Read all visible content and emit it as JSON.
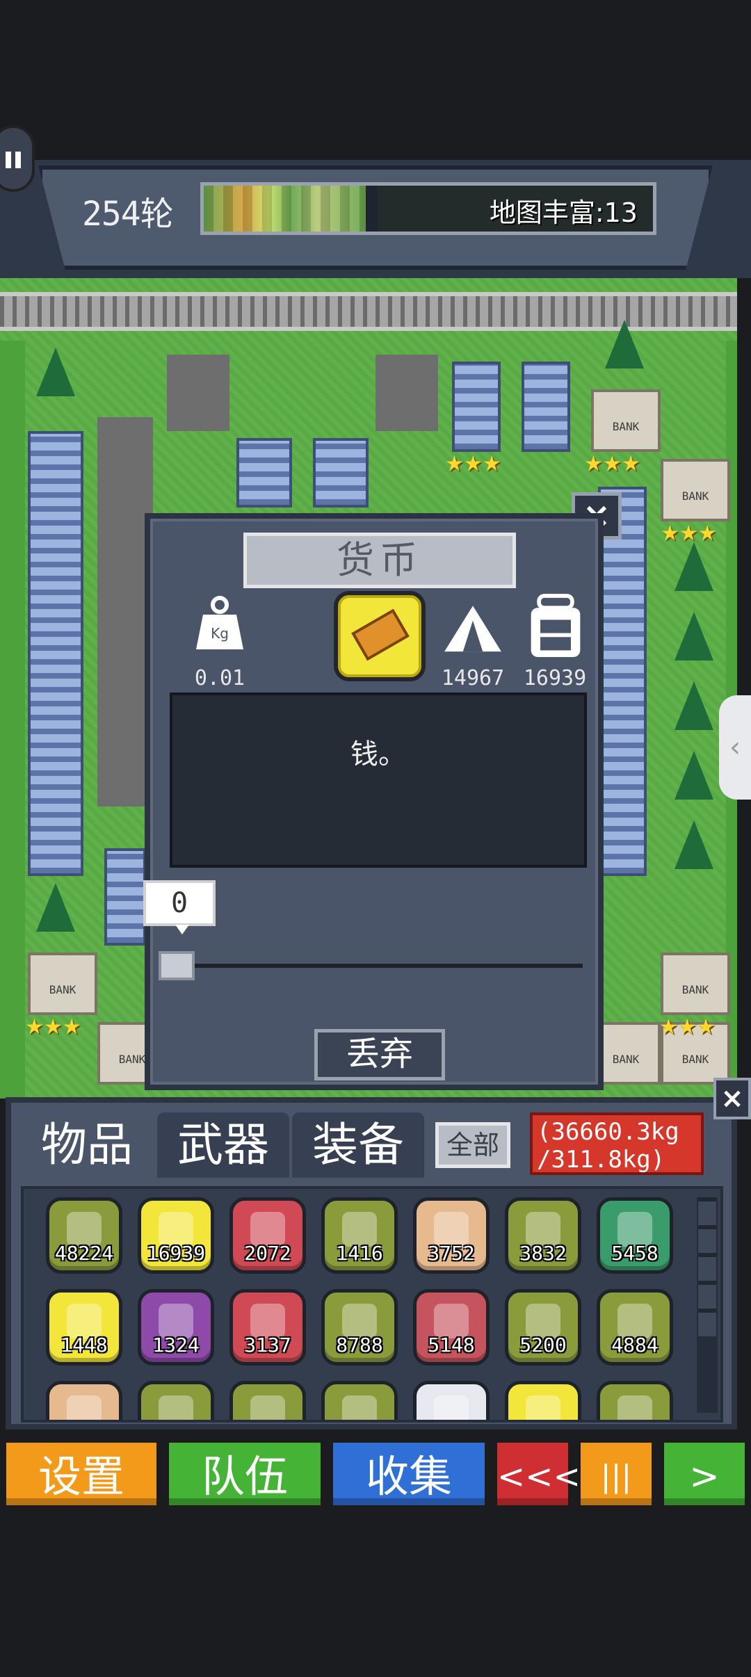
{
  "header": {
    "round": "254轮",
    "map_richness_label": "地图丰富:13",
    "map_richness_fill": 0.36
  },
  "dialog": {
    "title": "货币",
    "weight_unit": "Kg",
    "weight_value": "0.01",
    "camp_count": "14967",
    "backpack_count": "16939",
    "description": "钱。",
    "quantity": "0",
    "slider_value": 0,
    "discard_label": "丢弃",
    "close_label": "×"
  },
  "inventory": {
    "tabs": [
      "物品",
      "武器",
      "装备"
    ],
    "all_label": "全部",
    "weight_line1": "(36660.3kg",
    "weight_line2": "/311.8kg)",
    "close_label": "×",
    "rows": [
      [
        {
          "count": "48224",
          "bg": "#8a9b3c",
          "icon": "supplies-icon"
        },
        {
          "count": "16939",
          "bg": "#f2e63a",
          "icon": "currency-icon"
        },
        {
          "count": "2072",
          "bg": "#d04a55",
          "icon": "dynamite-icon"
        },
        {
          "count": "1416",
          "bg": "#8a9b3c",
          "icon": "herb-icon"
        },
        {
          "count": "3752",
          "bg": "#e7b98f",
          "icon": "rope-icon"
        },
        {
          "count": "3832",
          "bg": "#8a9b3c",
          "icon": "bottle-icon"
        },
        {
          "count": "5458",
          "bg": "#3a9c6a",
          "icon": "wood-log-icon"
        }
      ],
      [
        {
          "count": "1448",
          "bg": "#f2e63a",
          "icon": "potion-icon"
        },
        {
          "count": "1324",
          "bg": "#8d4aa8",
          "icon": "can-icon"
        },
        {
          "count": "3137",
          "bg": "#d04a55",
          "icon": "medkit-icon"
        },
        {
          "count": "8788",
          "bg": "#8a9b3c",
          "icon": "meat-icon"
        },
        {
          "count": "5148",
          "bg": "#c6545e",
          "icon": "shirt-icon"
        },
        {
          "count": "5200",
          "bg": "#8a9b3c",
          "icon": "chocolate-icon"
        },
        {
          "count": "4884",
          "bg": "#8a9b3c",
          "icon": "apple-icon"
        }
      ],
      [
        {
          "count": "",
          "bg": "#e7b98f",
          "icon": "mushroom-icon"
        },
        {
          "count": "",
          "bg": "#8a9b3c",
          "icon": "bread-icon"
        },
        {
          "count": "",
          "bg": "#8a9b3c",
          "icon": "egg-icon"
        },
        {
          "count": "",
          "bg": "#8a9b3c",
          "icon": "bullets-icon"
        },
        {
          "count": "",
          "bg": "#e8e8f0",
          "icon": "blueprint-icon"
        },
        {
          "count": "",
          "bg": "#f2e63a",
          "icon": "wine-bottle-icon"
        },
        {
          "count": "",
          "bg": "#8a9b3c",
          "icon": "pepper-icon"
        }
      ]
    ]
  },
  "bottom_nav": {
    "settings": "设置",
    "team": "队伍",
    "collect": "收集",
    "back": "<<<",
    "pause": "|||",
    "next": ">"
  },
  "map": {
    "bank_labels": [
      "BANK",
      "BANK",
      "BANK",
      "BANK",
      "BANK",
      "BANK",
      "BANK"
    ]
  },
  "colors": {
    "panel": "#4a5569",
    "panel_border": "#2c3444",
    "currency_yellow": "#f2e63a",
    "weight_red": "#d6372b"
  }
}
